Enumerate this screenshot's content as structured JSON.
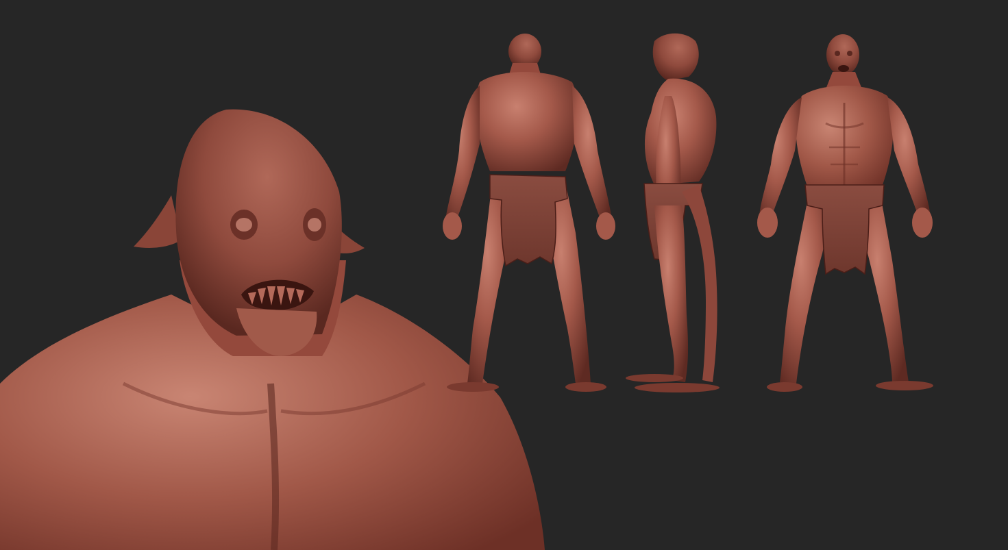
{
  "scene": {
    "background_color": "#262626",
    "material_color": "#9a4f42",
    "material_highlight": "#c57d6d",
    "material_shadow": "#5e2a22",
    "views": [
      {
        "name": "closeup-front"
      },
      {
        "name": "back"
      },
      {
        "name": "side"
      },
      {
        "name": "front"
      }
    ]
  }
}
